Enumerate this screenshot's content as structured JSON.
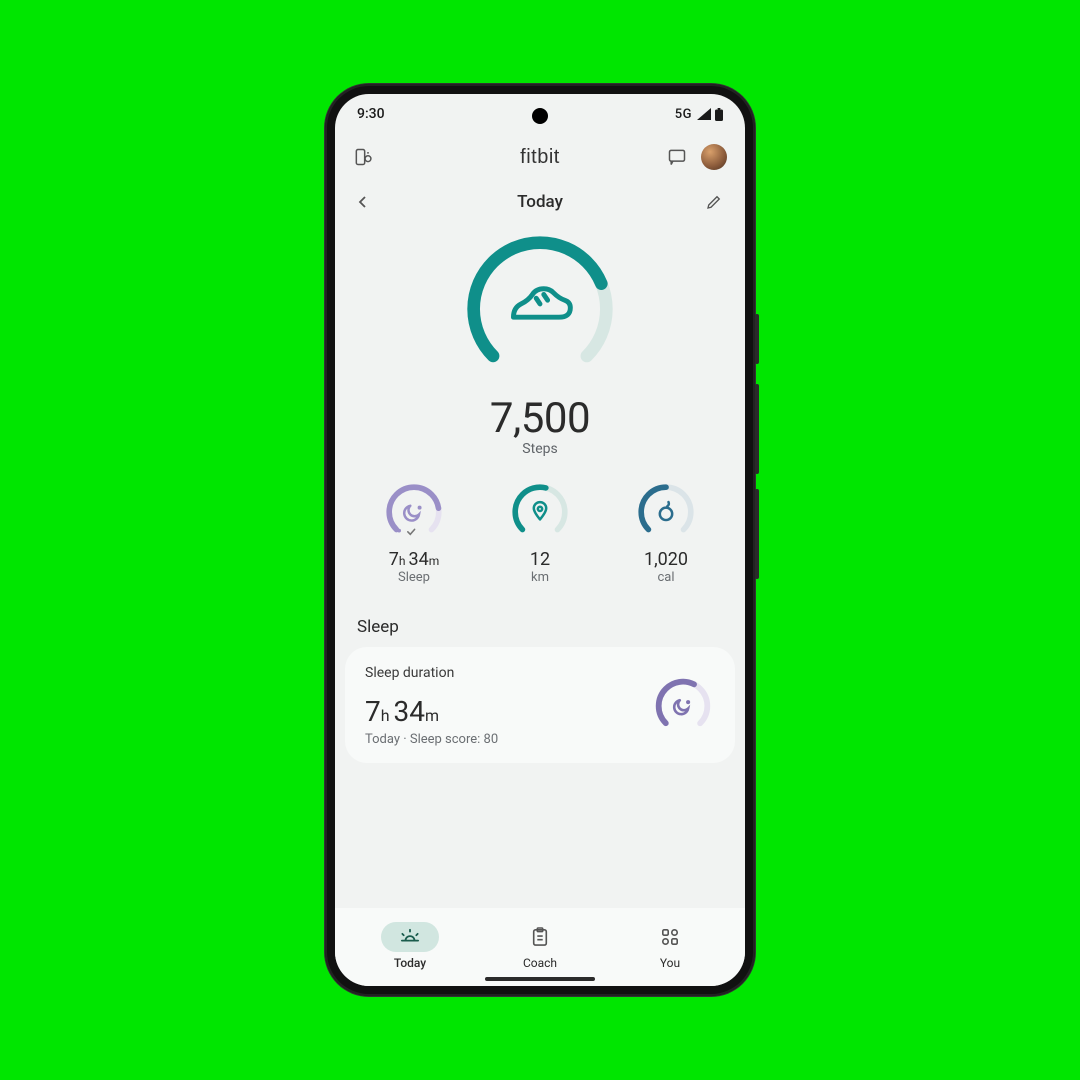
{
  "status": {
    "time": "9:30",
    "network": "5G"
  },
  "header": {
    "brand": "fitbit"
  },
  "subheader": {
    "title": "Today"
  },
  "hero": {
    "value": "7,500",
    "label": "Steps",
    "progress": 0.75
  },
  "metrics": [
    {
      "id": "sleep",
      "value_html": "7h 34m",
      "hours": "7",
      "minutes": "34",
      "label": "Sleep",
      "progress": 0.8,
      "color": "#9a8fc7"
    },
    {
      "id": "distance",
      "value": "12",
      "label": "km",
      "progress": 0.55,
      "color": "#0f8f8a"
    },
    {
      "id": "calories",
      "value": "1,020",
      "label": "cal",
      "progress": 0.5,
      "color": "#2b6d8d"
    }
  ],
  "sleep_section": {
    "title": "Sleep",
    "card_title": "Sleep duration",
    "hours": "7",
    "minutes": "34",
    "subline": "Today · Sleep score: 80",
    "progress": 0.6
  },
  "nav": [
    {
      "id": "today",
      "label": "Today",
      "active": true
    },
    {
      "id": "coach",
      "label": "Coach",
      "active": false
    },
    {
      "id": "you",
      "label": "You",
      "active": false
    }
  ],
  "chart_data": [
    {
      "type": "pie",
      "title": "Steps progress",
      "categories": [
        "completed",
        "remaining"
      ],
      "values": [
        75,
        25
      ]
    },
    {
      "type": "pie",
      "title": "Sleep progress",
      "categories": [
        "completed",
        "remaining"
      ],
      "values": [
        80,
        20
      ]
    },
    {
      "type": "pie",
      "title": "Distance progress",
      "categories": [
        "completed",
        "remaining"
      ],
      "values": [
        55,
        45
      ]
    },
    {
      "type": "pie",
      "title": "Calories progress",
      "categories": [
        "completed",
        "remaining"
      ],
      "values": [
        50,
        50
      ]
    },
    {
      "type": "pie",
      "title": "Sleep duration card progress",
      "categories": [
        "completed",
        "remaining"
      ],
      "values": [
        60,
        40
      ]
    }
  ]
}
